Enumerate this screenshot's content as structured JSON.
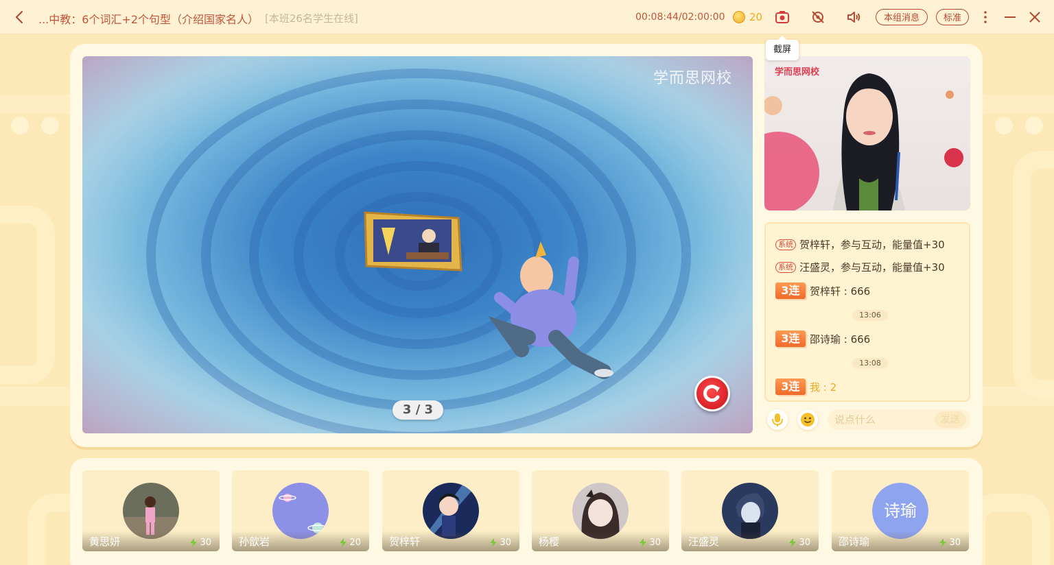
{
  "topbar": {
    "title": "...中教：6个词汇+2个句型（介绍国家名人）",
    "online_status": "[本班26名学生在线]",
    "timer": "00:08:44/02:00:00",
    "coin_count": "20",
    "group_message_label": "本组消息",
    "quality_label": "标准",
    "screenshot_tooltip": "截屏"
  },
  "stage": {
    "brand": "学而思网校",
    "page_indicator": "3 / 3"
  },
  "teacher_cam": {
    "brand": "学而思网校"
  },
  "chat": {
    "system_tag": "系统",
    "combo_label": "3连",
    "messages": [
      {
        "type": "system",
        "text": "贺梓轩，参与互动，能量值+30"
      },
      {
        "type": "system",
        "text": "汪盛灵，参与互动，能量值+30"
      },
      {
        "type": "combo",
        "text": "贺梓轩 : 666"
      },
      {
        "type": "time",
        "text": "13:06"
      },
      {
        "type": "combo",
        "text": "邵诗瑜 : 666"
      },
      {
        "type": "time",
        "text": "13:08"
      },
      {
        "type": "combo",
        "text": "我 : 2"
      }
    ],
    "input_placeholder": "说点什么",
    "send_label": "发送"
  },
  "students": [
    {
      "name": "黄思妍",
      "energy": "30",
      "avatar": "photo-girl"
    },
    {
      "name": "孙歆岩",
      "energy": "20",
      "avatar": "planet"
    },
    {
      "name": "贺梓轩",
      "energy": "30",
      "avatar": "anime-boy"
    },
    {
      "name": "杨樱",
      "energy": "30",
      "avatar": "anime-girl"
    },
    {
      "name": "汪盛灵",
      "energy": "30",
      "avatar": "anime-boy-blue"
    },
    {
      "name": "邵诗瑜",
      "energy": "30",
      "avatar": "text",
      "avatar_text": "诗瑜"
    }
  ],
  "colors": {
    "accent": "#c0553a",
    "energy_bolt": "#7ac93a",
    "coin": "#f0a923"
  }
}
